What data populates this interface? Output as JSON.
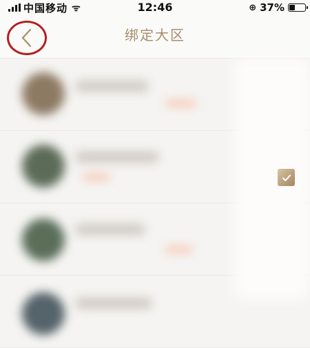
{
  "status_bar": {
    "carrier": "中国移动",
    "time": "12:46",
    "battery_percent": "37%",
    "battery_level": 0.37
  },
  "nav": {
    "title": "绑定大区",
    "back_icon": "chevron-left-icon"
  },
  "list": {
    "items": [
      {
        "avatar_color": "#8d7a63",
        "selected": false
      },
      {
        "avatar_color": "#5c6b58",
        "selected": false
      },
      {
        "avatar_color": "#5a6e5a",
        "selected": true
      },
      {
        "avatar_color": "#55636a",
        "selected": false
      }
    ]
  },
  "colors": {
    "accent_gold": "#a98c6a",
    "highlight_red": "#b3201f",
    "tag_orange": "#f6c8b4"
  }
}
